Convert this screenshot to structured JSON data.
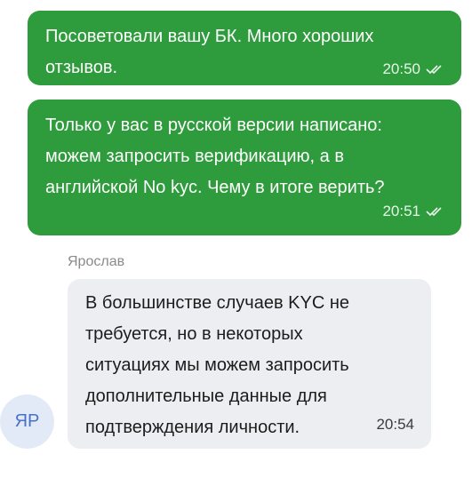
{
  "messages": [
    {
      "direction": "outgoing",
      "text": "Посоветовали вашу БК. Много хороших\nотзывов.",
      "time": "20:50",
      "status_icon": "double-check-icon"
    },
    {
      "direction": "outgoing",
      "text": "Только у вас в русской версии написано:\nможем запросить верификацию, а в\nанглийской No kyc. Чему в итоге верить?",
      "time": "20:51",
      "status_icon": "double-check-icon"
    },
    {
      "direction": "incoming",
      "sender": "Ярослав",
      "avatar_initials": "ЯР",
      "text": "В большинстве случаев KYC не\nтребуется, но в некоторых\nситуациях мы можем запросить\nдополнительные данные для\nподтверждения личности.",
      "time": "20:54"
    }
  ],
  "colors": {
    "outgoing_bubble": "#2e9b3c",
    "incoming_bubble": "#eceef1",
    "avatar_bg": "#e3eaf7",
    "avatar_text": "#4a72c4",
    "sender_name": "#8a8a8a"
  }
}
